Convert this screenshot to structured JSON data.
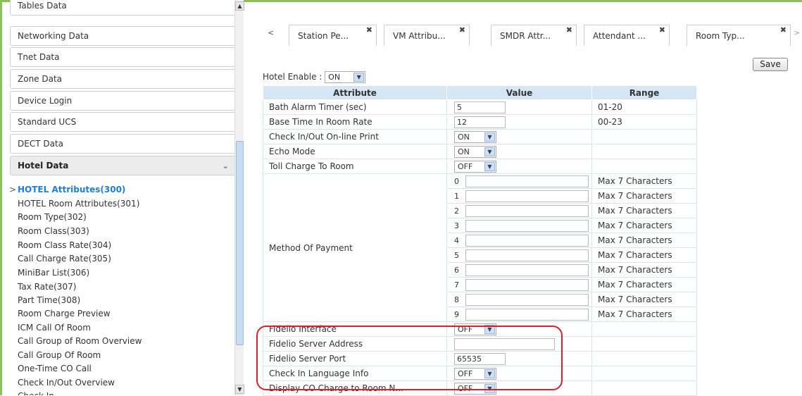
{
  "sidebar": {
    "menu": [
      {
        "label": "Tables Data"
      },
      {
        "label": "Networking Data"
      },
      {
        "label": "Tnet Data"
      },
      {
        "label": "Zone Data"
      },
      {
        "label": "Device Login"
      },
      {
        "label": "Standard UCS"
      },
      {
        "label": "DECT Data"
      },
      {
        "label": "Hotel Data"
      }
    ],
    "sub_items": [
      {
        "label": "HOTEL Attributes(300)"
      },
      {
        "label": "HOTEL Room Attributes(301)"
      },
      {
        "label": "Room Type(302)"
      },
      {
        "label": "Room Class(303)"
      },
      {
        "label": "Room Class Rate(304)"
      },
      {
        "label": "Call Charge Rate(305)"
      },
      {
        "label": "MiniBar List(306)"
      },
      {
        "label": "Tax Rate(307)"
      },
      {
        "label": "Part Time(308)"
      },
      {
        "label": "Room Charge Preview"
      },
      {
        "label": "ICM Call Of Room"
      },
      {
        "label": "Call Group of Room Overview"
      },
      {
        "label": "Call Group Of Room"
      },
      {
        "label": "One-Time CO Call"
      },
      {
        "label": "Check In/Out Overview"
      },
      {
        "label": "Check In"
      }
    ]
  },
  "tabs": [
    {
      "label": "Station Pe..."
    },
    {
      "label": "VM Attribu..."
    },
    {
      "label": "SMDR Attr..."
    },
    {
      "label": "Attendant ..."
    },
    {
      "label": "Room Typ..."
    }
  ],
  "toolbar": {
    "save_label": "Save"
  },
  "hotel_enable": {
    "label": "Hotel Enable :",
    "value": "ON"
  },
  "table": {
    "headers": {
      "attribute": "Attribute",
      "value": "Value",
      "range": "Range"
    },
    "rows": [
      {
        "attr": "Bath Alarm Timer (sec)",
        "value": "5",
        "range": "01-20"
      },
      {
        "attr": "Base Time In Room Rate",
        "value": "12",
        "range": "00-23"
      },
      {
        "attr": "Check In/Out On-line Print",
        "value": "ON",
        "range": ""
      },
      {
        "attr": "Echo Mode",
        "value": "ON",
        "range": ""
      },
      {
        "attr": "Toll Charge To Room",
        "value": "OFF",
        "range": ""
      }
    ],
    "payment": {
      "attr": "Method Of Payment",
      "indices": [
        "0",
        "1",
        "2",
        "3",
        "4",
        "5",
        "6",
        "7",
        "8",
        "9"
      ],
      "range": "Max 7 Characters"
    },
    "fidelio": [
      {
        "attr": "Fidelio Interface",
        "value": "OFF"
      },
      {
        "attr": "Fidelio Server Address",
        "value": ""
      },
      {
        "attr": "Fidelio Server Port",
        "value": "65535"
      },
      {
        "attr": "Check In Language Info",
        "value": "OFF"
      }
    ],
    "last_row": {
      "attr": "Display CO Charge to Room N...",
      "value": "OFF"
    }
  }
}
